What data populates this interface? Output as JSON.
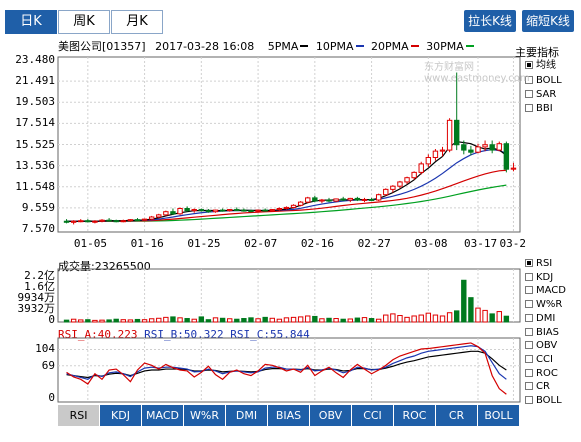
{
  "period_tabs": [
    {
      "label": "日K",
      "active": true
    },
    {
      "label": "周K",
      "active": false
    },
    {
      "label": "月K",
      "active": false
    }
  ],
  "toolbar": {
    "stretch_label": "拉长K线",
    "shrink_label": "缩短K线"
  },
  "chart_header": {
    "stock": "美图公司[01357]",
    "datetime": "2017-03-28 16:08",
    "ma5": "5PMA",
    "ma10": "10PMA",
    "ma20": "20PMA",
    "ma30": "30PMA"
  },
  "watermark": "东方财富网 www.eastmoney.com",
  "main_indicators": {
    "title": "主要指标",
    "items": [
      {
        "label": "均线",
        "checked": true
      },
      {
        "label": "BOLL",
        "checked": false
      },
      {
        "label": "SAR",
        "checked": false
      },
      {
        "label": "BBI",
        "checked": false
      }
    ]
  },
  "sub_indicators": [
    {
      "label": "RSI",
      "checked": true
    },
    {
      "label": "KDJ",
      "checked": false
    },
    {
      "label": "MACD",
      "checked": false
    },
    {
      "label": "W%R",
      "checked": false
    },
    {
      "label": "DMI",
      "checked": false
    },
    {
      "label": "BIAS",
      "checked": false
    },
    {
      "label": "OBV",
      "checked": false
    },
    {
      "label": "CCI",
      "checked": false
    },
    {
      "label": "ROC",
      "checked": false
    },
    {
      "label": "CR",
      "checked": false
    },
    {
      "label": "BOLL",
      "checked": false
    }
  ],
  "volume": {
    "label": "成交量:23265500",
    "yticks": [
      "2.2亿",
      "1.6亿",
      "9934万",
      "3932万",
      "0"
    ]
  },
  "rsi": {
    "label_a": "RSI_A:40.223",
    "label_b": "RSI_B:50.322",
    "label_c": "RSI_C:55.844",
    "yticks": [
      "104",
      "69",
      "0"
    ]
  },
  "bottom_tabs": [
    {
      "label": "RSI",
      "active": true
    },
    {
      "label": "KDJ",
      "active": false
    },
    {
      "label": "MACD",
      "active": false
    },
    {
      "label": "W%R",
      "active": false
    },
    {
      "label": "DMI",
      "active": false
    },
    {
      "label": "BIAS",
      "active": false
    },
    {
      "label": "OBV",
      "active": false
    },
    {
      "label": "CCI",
      "active": false
    },
    {
      "label": "ROC",
      "active": false
    },
    {
      "label": "CR",
      "active": false
    },
    {
      "label": "BOLL",
      "active": false
    }
  ],
  "colors": {
    "up": "#e00000",
    "down": "#007a1e",
    "ma5": "#000000",
    "ma10": "#1b36b0",
    "ma20": "#d40000",
    "ma30": "#00a020",
    "accent": "#1f5fa8",
    "rsi_a": "#d40000",
    "rsi_b": "#1b36b0",
    "rsi_c": "#000000"
  },
  "chart_data": {
    "type": "candlestick",
    "yticks": [
      "23.480",
      "21.491",
      "19.503",
      "17.514",
      "15.525",
      "13.536",
      "11.548",
      "9.559",
      "7.570"
    ],
    "ylim": [
      7.57,
      23.48
    ],
    "xticks": [
      "01-05",
      "01-16",
      "01-25",
      "02-07",
      "02-16",
      "02-27",
      "03-08",
      "03-17",
      "03-2"
    ],
    "candles": [
      {
        "o": 8.3,
        "h": 8.5,
        "l": 8.1,
        "c": 8.2
      },
      {
        "o": 8.2,
        "h": 8.4,
        "l": 8.0,
        "c": 8.3
      },
      {
        "o": 8.3,
        "h": 8.5,
        "l": 8.2,
        "c": 8.35
      },
      {
        "o": 8.35,
        "h": 8.5,
        "l": 8.2,
        "c": 8.25
      },
      {
        "o": 8.25,
        "h": 8.4,
        "l": 8.1,
        "c": 8.3
      },
      {
        "o": 8.3,
        "h": 8.5,
        "l": 8.2,
        "c": 8.4
      },
      {
        "o": 8.4,
        "h": 8.6,
        "l": 8.3,
        "c": 8.35
      },
      {
        "o": 8.35,
        "h": 8.45,
        "l": 8.2,
        "c": 8.3
      },
      {
        "o": 8.3,
        "h": 8.45,
        "l": 8.2,
        "c": 8.35
      },
      {
        "o": 8.35,
        "h": 8.5,
        "l": 8.25,
        "c": 8.45
      },
      {
        "o": 8.45,
        "h": 8.6,
        "l": 8.3,
        "c": 8.4
      },
      {
        "o": 8.4,
        "h": 8.55,
        "l": 8.3,
        "c": 8.5
      },
      {
        "o": 8.5,
        "h": 8.8,
        "l": 8.4,
        "c": 8.7
      },
      {
        "o": 8.7,
        "h": 9.0,
        "l": 8.6,
        "c": 8.9
      },
      {
        "o": 8.9,
        "h": 9.3,
        "l": 8.8,
        "c": 9.2
      },
      {
        "o": 9.2,
        "h": 9.5,
        "l": 8.9,
        "c": 9.0
      },
      {
        "o": 9.0,
        "h": 9.6,
        "l": 8.9,
        "c": 9.5
      },
      {
        "o": 9.5,
        "h": 9.7,
        "l": 9.2,
        "c": 9.3
      },
      {
        "o": 9.3,
        "h": 9.5,
        "l": 9.1,
        "c": 9.4
      },
      {
        "o": 9.4,
        "h": 9.5,
        "l": 9.2,
        "c": 9.3
      },
      {
        "o": 9.3,
        "h": 9.45,
        "l": 9.1,
        "c": 9.2
      },
      {
        "o": 9.2,
        "h": 9.4,
        "l": 9.1,
        "c": 9.35
      },
      {
        "o": 9.35,
        "h": 9.5,
        "l": 9.2,
        "c": 9.3
      },
      {
        "o": 9.3,
        "h": 9.45,
        "l": 9.2,
        "c": 9.4
      },
      {
        "o": 9.4,
        "h": 9.6,
        "l": 9.3,
        "c": 9.35
      },
      {
        "o": 9.35,
        "h": 9.5,
        "l": 9.2,
        "c": 9.3
      },
      {
        "o": 9.3,
        "h": 9.4,
        "l": 9.15,
        "c": 9.25
      },
      {
        "o": 9.25,
        "h": 9.4,
        "l": 9.1,
        "c": 9.35
      },
      {
        "o": 9.35,
        "h": 9.5,
        "l": 9.2,
        "c": 9.3
      },
      {
        "o": 9.3,
        "h": 9.45,
        "l": 9.2,
        "c": 9.4
      },
      {
        "o": 9.4,
        "h": 9.6,
        "l": 9.3,
        "c": 9.5
      },
      {
        "o": 9.5,
        "h": 9.7,
        "l": 9.4,
        "c": 9.6
      },
      {
        "o": 9.6,
        "h": 9.9,
        "l": 9.5,
        "c": 9.8
      },
      {
        "o": 9.8,
        "h": 10.2,
        "l": 9.7,
        "c": 10.1
      },
      {
        "o": 10.1,
        "h": 10.6,
        "l": 10.0,
        "c": 10.5
      },
      {
        "o": 10.5,
        "h": 10.7,
        "l": 10.1,
        "c": 10.2
      },
      {
        "o": 10.2,
        "h": 10.4,
        "l": 10.0,
        "c": 10.3
      },
      {
        "o": 10.3,
        "h": 10.5,
        "l": 10.1,
        "c": 10.2
      },
      {
        "o": 10.2,
        "h": 10.45,
        "l": 10.1,
        "c": 10.4
      },
      {
        "o": 10.4,
        "h": 10.6,
        "l": 10.2,
        "c": 10.3
      },
      {
        "o": 10.3,
        "h": 10.5,
        "l": 10.1,
        "c": 10.45
      },
      {
        "o": 10.45,
        "h": 10.6,
        "l": 10.2,
        "c": 10.3
      },
      {
        "o": 10.3,
        "h": 10.5,
        "l": 10.1,
        "c": 10.35
      },
      {
        "o": 10.35,
        "h": 10.5,
        "l": 10.2,
        "c": 10.3
      },
      {
        "o": 10.3,
        "h": 10.9,
        "l": 10.2,
        "c": 10.8
      },
      {
        "o": 10.8,
        "h": 11.4,
        "l": 10.7,
        "c": 11.3
      },
      {
        "o": 11.3,
        "h": 11.7,
        "l": 11.0,
        "c": 11.6
      },
      {
        "o": 11.6,
        "h": 12.1,
        "l": 11.4,
        "c": 12.0
      },
      {
        "o": 12.0,
        "h": 12.5,
        "l": 11.8,
        "c": 12.4
      },
      {
        "o": 12.4,
        "h": 13.0,
        "l": 12.2,
        "c": 12.9
      },
      {
        "o": 12.9,
        "h": 13.9,
        "l": 12.7,
        "c": 13.7
      },
      {
        "o": 13.7,
        "h": 14.6,
        "l": 13.4,
        "c": 14.3
      },
      {
        "o": 14.3,
        "h": 15.1,
        "l": 14.0,
        "c": 14.9
      },
      {
        "o": 14.9,
        "h": 15.3,
        "l": 14.4,
        "c": 15.0
      },
      {
        "o": 15.0,
        "h": 18.0,
        "l": 14.8,
        "c": 17.8
      },
      {
        "o": 17.8,
        "h": 22.3,
        "l": 15.0,
        "c": 15.5
      },
      {
        "o": 15.5,
        "h": 15.9,
        "l": 14.6,
        "c": 15.0
      },
      {
        "o": 15.0,
        "h": 15.4,
        "l": 14.5,
        "c": 14.8
      },
      {
        "o": 14.8,
        "h": 15.6,
        "l": 14.7,
        "c": 15.3
      },
      {
        "o": 15.3,
        "h": 15.9,
        "l": 14.9,
        "c": 15.5
      },
      {
        "o": 15.5,
        "h": 15.9,
        "l": 14.7,
        "c": 15.0
      },
      {
        "o": 15.0,
        "h": 15.8,
        "l": 14.9,
        "c": 15.6
      },
      {
        "o": 15.6,
        "h": 15.8,
        "l": 12.9,
        "c": 13.2
      },
      {
        "o": 13.2,
        "h": 13.8,
        "l": 13.0,
        "c": 13.3
      }
    ],
    "ma5": [
      8.3,
      8.28,
      8.3,
      8.32,
      8.3,
      8.32,
      8.36,
      8.35,
      8.35,
      8.38,
      8.4,
      8.42,
      8.5,
      8.62,
      8.8,
      8.95,
      9.1,
      9.2,
      9.3,
      9.3,
      9.32,
      9.3,
      9.3,
      9.32,
      9.33,
      9.34,
      9.33,
      9.31,
      9.3,
      9.32,
      9.37,
      9.45,
      9.58,
      9.8,
      10.05,
      10.2,
      10.28,
      10.3,
      10.3,
      10.3,
      10.33,
      10.33,
      10.34,
      10.34,
      10.45,
      10.7,
      11.0,
      11.35,
      11.75,
      12.2,
      12.8,
      13.3,
      13.9,
      14.4,
      15.3,
      15.8,
      15.7,
      15.6,
      15.3,
      15.1,
      15.2,
      15.0,
      14.5
    ],
    "ma10": [
      8.3,
      8.3,
      8.3,
      8.3,
      8.3,
      8.31,
      8.32,
      8.33,
      8.34,
      8.35,
      8.37,
      8.39,
      8.43,
      8.5,
      8.6,
      8.7,
      8.82,
      8.92,
      9.02,
      9.1,
      9.17,
      9.22,
      9.26,
      9.28,
      9.3,
      9.31,
      9.31,
      9.31,
      9.31,
      9.32,
      9.34,
      9.37,
      9.42,
      9.52,
      9.66,
      9.8,
      9.92,
      10.03,
      10.12,
      10.2,
      10.26,
      10.3,
      10.31,
      10.32,
      10.38,
      10.5,
      10.66,
      10.84,
      11.05,
      11.3,
      11.6,
      11.95,
      12.35,
      12.8,
      13.3,
      13.8,
      14.2,
      14.55,
      14.8,
      14.95,
      15.05,
      14.95,
      14.7
    ],
    "ma20": [
      8.3,
      8.3,
      8.3,
      8.3,
      8.3,
      8.3,
      8.3,
      8.31,
      8.31,
      8.32,
      8.33,
      8.34,
      8.36,
      8.4,
      8.45,
      8.5,
      8.56,
      8.62,
      8.68,
      8.74,
      8.8,
      8.86,
      8.92,
      8.98,
      9.03,
      9.08,
      9.12,
      9.16,
      9.19,
      9.22,
      9.25,
      9.28,
      9.31,
      9.35,
      9.4,
      9.46,
      9.53,
      9.61,
      9.7,
      9.78,
      9.86,
      9.93,
      9.99,
      10.05,
      10.11,
      10.18,
      10.26,
      10.35,
      10.46,
      10.6,
      10.76,
      10.94,
      11.14,
      11.36,
      11.6,
      11.85,
      12.1,
      12.33,
      12.55,
      12.75,
      12.92,
      13.05,
      13.1
    ],
    "ma30": [
      8.3,
      8.3,
      8.3,
      8.3,
      8.3,
      8.3,
      8.3,
      8.3,
      8.3,
      8.3,
      8.31,
      8.31,
      8.32,
      8.33,
      8.35,
      8.37,
      8.4,
      8.43,
      8.46,
      8.5,
      8.54,
      8.58,
      8.62,
      8.66,
      8.7,
      8.74,
      8.78,
      8.82,
      8.86,
      8.9,
      8.94,
      8.98,
      9.02,
      9.06,
      9.1,
      9.15,
      9.2,
      9.25,
      9.3,
      9.36,
      9.42,
      9.48,
      9.54,
      9.6,
      9.66,
      9.73,
      9.8,
      9.88,
      9.97,
      10.06,
      10.16,
      10.27,
      10.39,
      10.52,
      10.66,
      10.81,
      10.96,
      11.1,
      11.24,
      11.37,
      11.49,
      11.6,
      11.7
    ],
    "volume_ylim": [
      0,
      22000
    ],
    "volumes": [
      800,
      1200,
      900,
      1000,
      700,
      800,
      900,
      1200,
      1000,
      900,
      1100,
      1000,
      1400,
      1600,
      2000,
      2200,
      1800,
      1500,
      1200,
      2200,
      1000,
      1800,
      1600,
      1400,
      1200,
      1500,
      1800,
      1400,
      2000,
      1600,
      1200,
      1800,
      2000,
      2200,
      2600,
      2400,
      1400,
      1600,
      1500,
      1200,
      1300,
      1700,
      1900,
      1500,
      1200,
      3000,
      3500,
      2800,
      2000,
      2600,
      3000,
      3800,
      3000,
      2600,
      4000,
      4800,
      18000,
      10500,
      6000,
      5000,
      3500,
      4500,
      2500
    ],
    "rsi_ylim": [
      0,
      120
    ],
    "rsi_a": [
      55,
      45,
      40,
      30,
      52,
      40,
      60,
      62,
      50,
      35,
      60,
      75,
      70,
      62,
      72,
      65,
      60,
      58,
      45,
      55,
      68,
      50,
      40,
      55,
      60,
      52,
      48,
      58,
      72,
      70,
      65,
      58,
      62,
      55,
      70,
      48,
      58,
      66,
      54,
      44,
      60,
      72,
      62,
      52,
      60,
      70,
      82,
      90,
      95,
      100,
      105,
      106,
      108,
      110,
      112,
      114,
      116,
      118,
      110,
      96,
      48,
      20,
      8
    ],
    "rsi_b": [
      52,
      48,
      44,
      40,
      50,
      46,
      54,
      56,
      52,
      46,
      56,
      64,
      66,
      64,
      66,
      66,
      64,
      62,
      56,
      57,
      62,
      58,
      52,
      56,
      58,
      56,
      54,
      56,
      64,
      66,
      66,
      62,
      62,
      60,
      65,
      58,
      60,
      64,
      60,
      54,
      58,
      66,
      64,
      60,
      62,
      66,
      74,
      80,
      86,
      90,
      96,
      100,
      102,
      104,
      106,
      108,
      110,
      112,
      110,
      100,
      76,
      52,
      40
    ],
    "rsi_c": [
      50,
      48,
      46,
      44,
      48,
      47,
      51,
      53,
      52,
      48,
      53,
      58,
      60,
      60,
      62,
      62,
      62,
      61,
      58,
      58,
      60,
      59,
      56,
      57,
      58,
      57,
      56,
      57,
      61,
      63,
      63,
      62,
      62,
      61,
      63,
      60,
      60,
      62,
      61,
      58,
      59,
      63,
      63,
      61,
      61,
      64,
      68,
      73,
      77,
      80,
      84,
      88,
      90,
      92,
      94,
      96,
      98,
      100,
      100,
      96,
      84,
      70,
      60
    ]
  }
}
